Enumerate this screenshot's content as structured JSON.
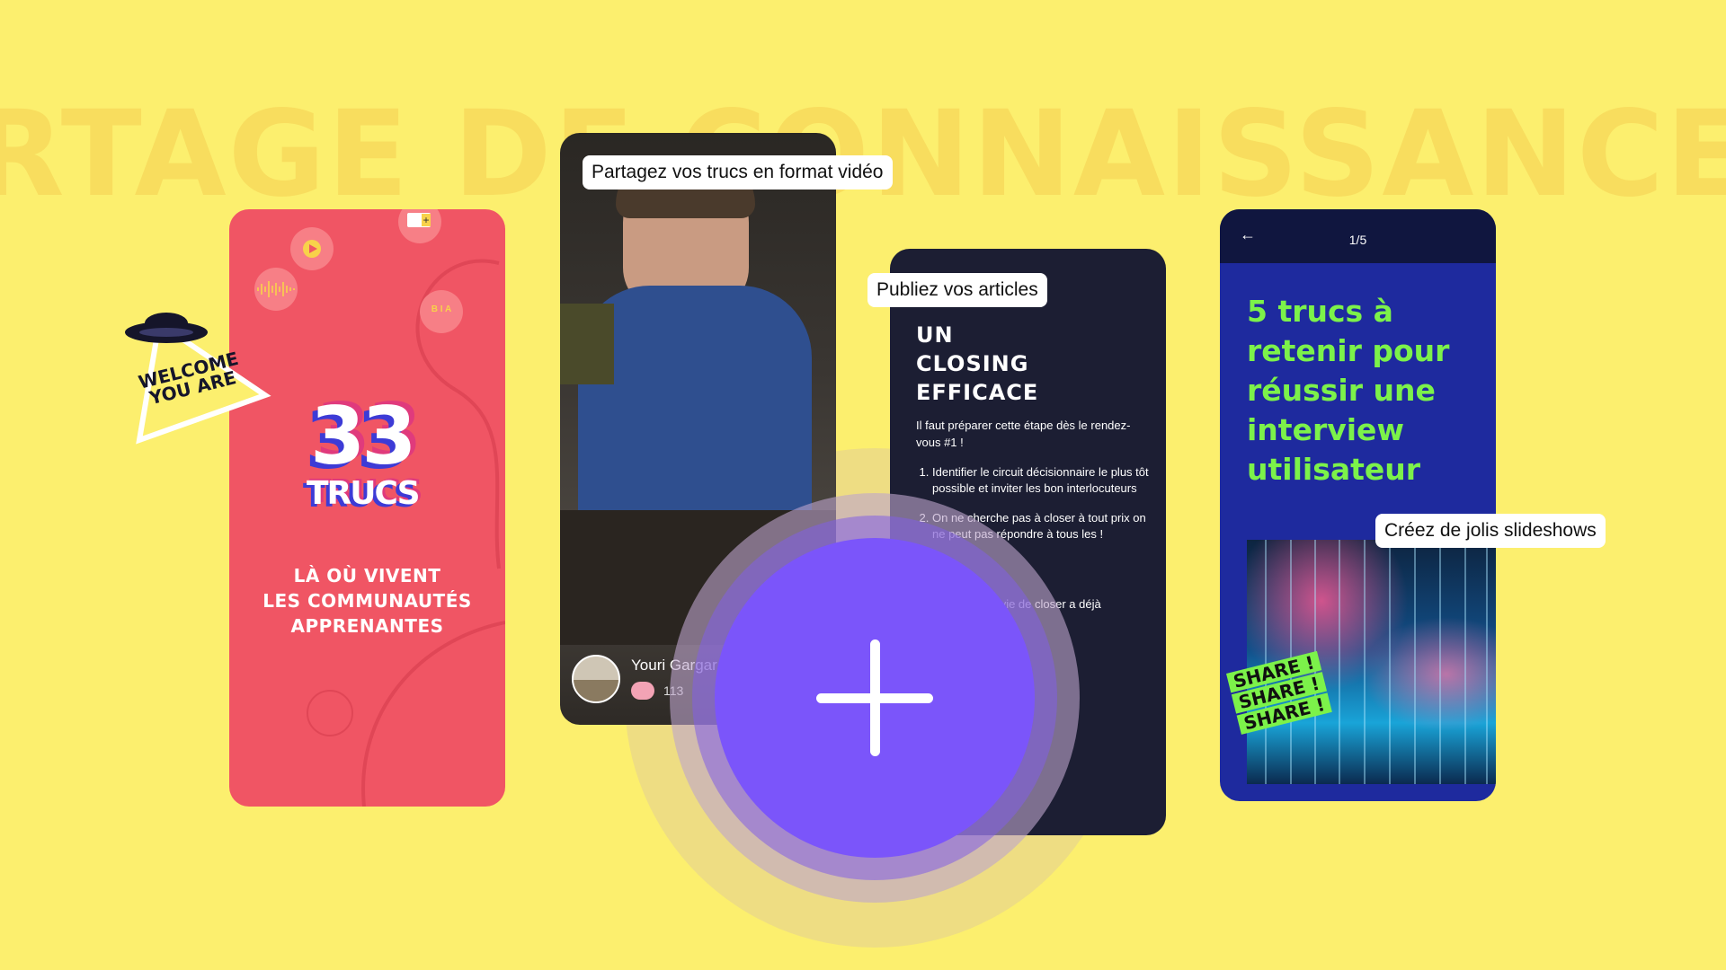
{
  "background_word": "RTAGE DE CONNAISSANCE",
  "colors": {
    "background": "#FCEF6E",
    "red_card": "#F05564",
    "dark_card": "#1C1E33",
    "slides_card": "#1E2A9E",
    "accent_purple": "#7B55FA",
    "accent_green": "#7CF24A"
  },
  "sticker": {
    "text_line1": "WELCOME",
    "text_line2": "YOU ARE",
    "icon": "ufo-icon"
  },
  "red_card": {
    "logo_number": "33",
    "logo_word": "TRUCS",
    "slogan_line1": "LÀ OÙ VIVENT",
    "slogan_line2": "LES COMMUNAUTÉS",
    "slogan_line3": "APPRENANTES",
    "format_bubble": "B I A",
    "icons": [
      "play-icon",
      "add-image-icon",
      "audio-wave-icon",
      "text-format-icon"
    ]
  },
  "video_card": {
    "tag": "Partagez vos trucs en format vidéo",
    "author": "Youri Gargar",
    "count": "113",
    "count_icon": "brain-icon"
  },
  "article_card": {
    "tag": "Publiez vos articles",
    "title_line1": "UN",
    "title_line2": "CLOSING",
    "title_line3": "EFFICACE",
    "intro": "Il faut préparer cette étape dès le rendez-vous #1 !",
    "list": [
      "Identifier le circuit décisionnaire le plus tôt possible et inviter les bon interlocuteurs",
      "On ne cherche pas à closer à tout prix on ne peut pas répondre à tous les !"
    ],
    "extra": "lus envie de closer a déjà"
  },
  "slides_card": {
    "tag": "Créez de jolis slideshows",
    "page": "1/5",
    "back_icon": "arrow-left-icon",
    "title": "5 trucs à retenir pour réussir une interview utilisateur",
    "share_line1": "SHARE !",
    "share_line2": "SHARE !",
    "share_line3": "SHARE !"
  },
  "add_button": {
    "icon": "plus-icon"
  }
}
